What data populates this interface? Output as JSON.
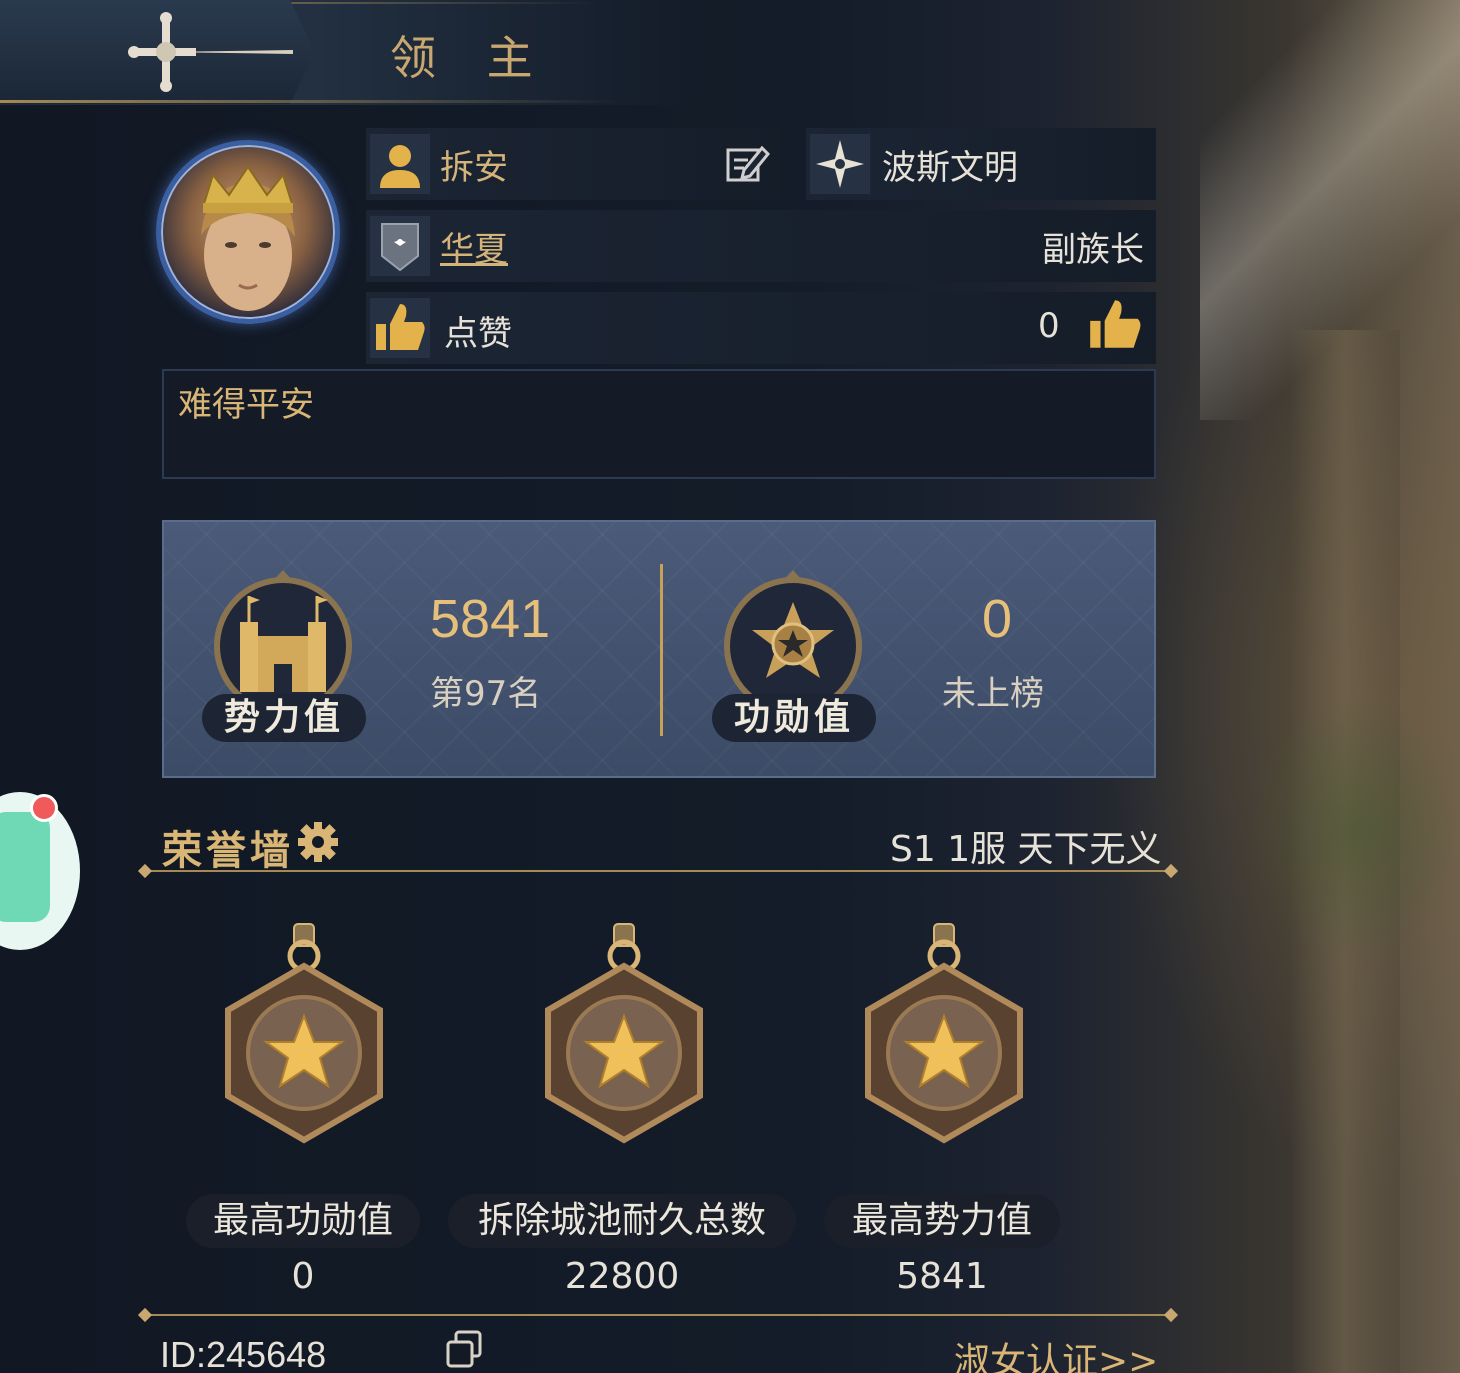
{
  "header": {
    "title": "领 主",
    "emblem_icon": "cross-sword-icon"
  },
  "profile": {
    "name": "拆安",
    "edit_icon": "edit-icon",
    "civilization_icon": "compass-star-icon",
    "civilization": "波斯文明",
    "alliance_name": "华夏",
    "alliance_role": "副族长",
    "likes_label": "点赞",
    "likes_count": "0",
    "motto": "难得平安"
  },
  "stats": {
    "power": {
      "label": "势力值",
      "value": "5841",
      "rank": "第97名"
    },
    "merit": {
      "label": "功勋值",
      "value": "0",
      "rank": "未上榜"
    }
  },
  "honor_wall": {
    "title": "荣誉墙",
    "season": "S1 1服 天下无义",
    "medals": [
      {
        "label": "最高功勋值",
        "value": "0"
      },
      {
        "label": "拆除城池耐久总数",
        "value": "22800"
      },
      {
        "label": "最高势力值",
        "value": "5841"
      }
    ]
  },
  "footer": {
    "id_text": "ID:245648",
    "link_text": "淑女认证>>"
  },
  "colors": {
    "gold": "#d5b47a",
    "panel": "#4a5a78",
    "background": "#131a26"
  }
}
